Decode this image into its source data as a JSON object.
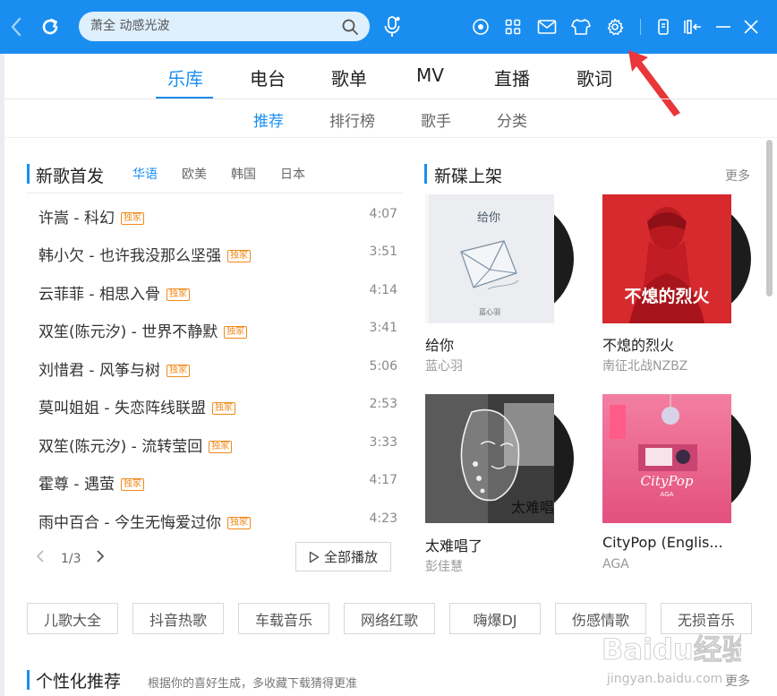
{
  "titlebar": {
    "search_value": "萧全  动感光波"
  },
  "main_nav": [
    {
      "label": "乐库",
      "active": true
    },
    {
      "label": "电台",
      "active": false
    },
    {
      "label": "歌单",
      "active": false
    },
    {
      "label": "MV",
      "active": false
    },
    {
      "label": "直播",
      "active": false
    },
    {
      "label": "歌词",
      "active": false
    }
  ],
  "sub_nav": [
    {
      "label": "推荐",
      "active": true
    },
    {
      "label": "排行榜",
      "active": false
    },
    {
      "label": "歌手",
      "active": false
    },
    {
      "label": "分类",
      "active": false
    }
  ],
  "new_songs": {
    "title": "新歌首发",
    "regions": [
      {
        "label": "华语",
        "active": true
      },
      {
        "label": "欧美",
        "active": false
      },
      {
        "label": "韩国",
        "active": false
      },
      {
        "label": "日本",
        "active": false
      }
    ],
    "badge": "独家",
    "songs": [
      {
        "name": "许嵩 - 科幻",
        "duration": "4:07"
      },
      {
        "name": "韩小欠 - 也许我没那么坚强",
        "duration": "3:51"
      },
      {
        "name": "云菲菲 - 相思入骨",
        "duration": "4:14"
      },
      {
        "name": "双笙(陈元汐) - 世界不静默",
        "duration": "3:41"
      },
      {
        "name": "刘惜君 - 风筝与树",
        "duration": "5:06"
      },
      {
        "name": "莫叫姐姐 - 失恋阵线联盟",
        "duration": "2:53"
      },
      {
        "name": "双笙(陈元汐) - 流转莹回",
        "duration": "3:33"
      },
      {
        "name": "霍尊 - 遇萤",
        "duration": "4:17"
      },
      {
        "name": "雨中百合 - 今生无悔爱过你",
        "duration": "4:23"
      }
    ],
    "page": "1/3",
    "play_all": "全部播放"
  },
  "new_albums": {
    "title": "新碟上架",
    "more": "更多",
    "albums": [
      {
        "title": "给你",
        "artist": "蓝心羽",
        "cover_text": "给你"
      },
      {
        "title": "不熄的烈火",
        "artist": "南征北战NZBZ",
        "cover_text": "不熄的烈火"
      },
      {
        "title": "太难唱了",
        "artist": "彭佳慧",
        "cover_text": "太难唱了"
      },
      {
        "title": "CityPop (Englis...",
        "artist": "AGA",
        "cover_text": "CityPop"
      }
    ]
  },
  "tags": [
    "儿歌大全",
    "抖音热歌",
    "车载音乐",
    "网络红歌",
    "嗨爆DJ",
    "伤感情歌",
    "无损音乐"
  ],
  "personalized": {
    "title": "个性化推荐",
    "subtitle": "根据你的喜好生成，多收藏下载猜得更准",
    "more": "更多"
  },
  "watermark": {
    "brand": "Baidu经验",
    "url": "jingyan.baidu.com"
  },
  "colors": {
    "accent": "#1a8ef0",
    "badge": "#f08a1c",
    "annotation_arrow": "#e8363a"
  }
}
